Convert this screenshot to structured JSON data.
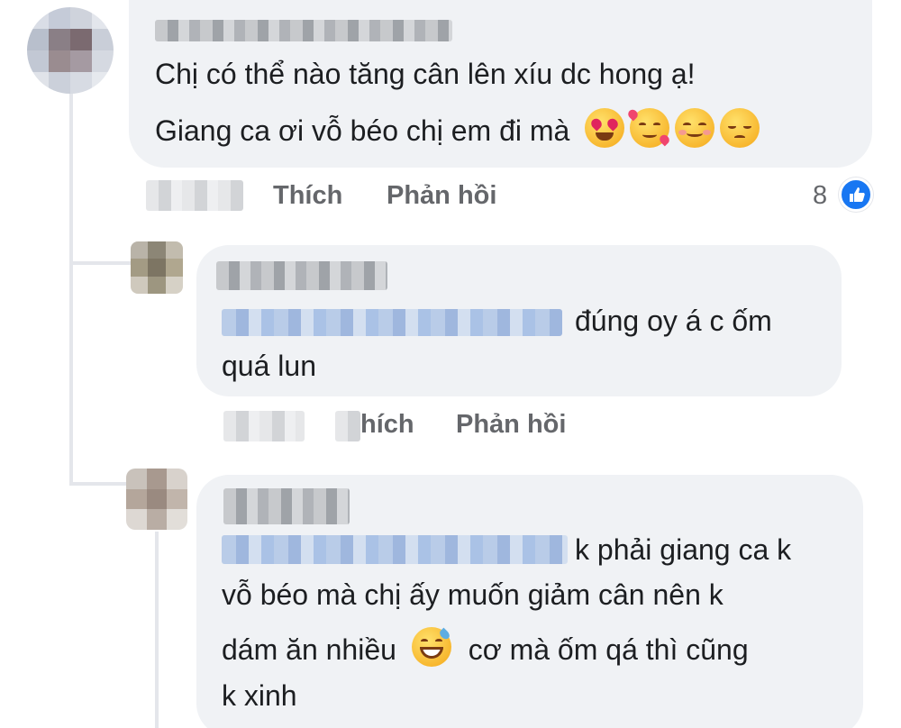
{
  "comment": {
    "text_line1": "Chị có thể nào tăng cân lên xíu dc hong ạ!",
    "text_line2": "Giang ca ơi vỗ béo chị em đi mà",
    "emojis": [
      "heart-eyes",
      "smiling-hearts",
      "blush",
      "pensive"
    ],
    "actions": {
      "like": "Thích",
      "reply": "Phản hồi"
    },
    "reaction_count": "8",
    "reaction_icon": "thumbs-up-icon"
  },
  "reply1": {
    "text_line1": "đúng oy á c ốm",
    "text_line2": "quá lun",
    "actions": {
      "like": "hích",
      "reply": "Phản hồi"
    }
  },
  "reply2": {
    "text_line1": "k phải giang ca k",
    "text_line2": "vỗ béo mà chị ấy muốn giảm cân nên k",
    "text_line3a": "dám ăn nhiều",
    "text_line3b": "cơ mà ốm qá thì cũng",
    "text_line4": "k xinh",
    "emoji": "grinning-sweat"
  },
  "colors": {
    "bubble": "#f0f2f5",
    "text": "#1c1e21",
    "secondary": "#65676b",
    "link": "#1877f2",
    "thread_line": "#e4e6eb"
  }
}
